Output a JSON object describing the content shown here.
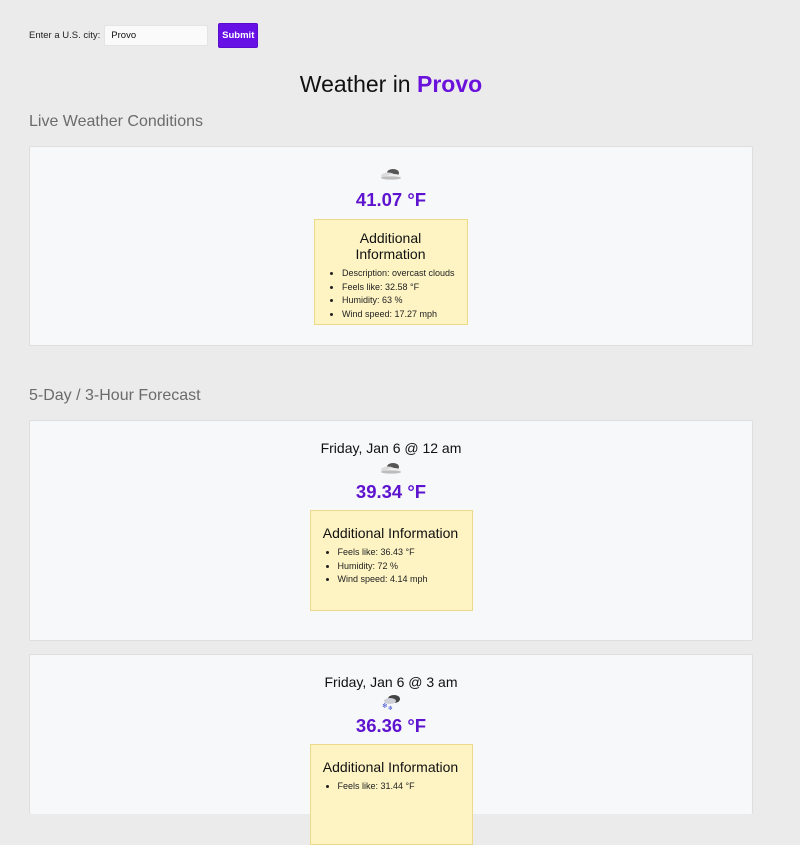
{
  "search": {
    "label": "Enter a U.S. city:",
    "value": "Provo",
    "submit_label": "Submit"
  },
  "title": {
    "prefix": "Weather in",
    "city": "Provo"
  },
  "live": {
    "heading": "Live Weather Conditions",
    "icon": "overcast-clouds-icon",
    "temp": "41.07 °F",
    "info_title": "Additional Information",
    "details": [
      "Description: overcast clouds",
      "Feels like: 32.58 °F",
      "Humidity: 63 %",
      "Wind speed: 17.27 mph"
    ]
  },
  "forecast": {
    "heading": "5-Day / 3-Hour Forecast",
    "items": [
      {
        "date": "Friday, Jan 6 @ 12 am",
        "icon": "overcast-clouds-icon",
        "temp": "39.34 °F",
        "info_title": "Additional Information",
        "details": [
          "Feels like: 36.43 °F",
          "Humidity: 72 %",
          "Wind speed: 4.14 mph"
        ]
      },
      {
        "date": "Friday, Jan 6 @ 3 am",
        "icon": "snow-icon",
        "temp": "36.36 °F",
        "info_title": "Additional Information",
        "details": [
          "Feels like: 31.44 °F"
        ]
      }
    ]
  },
  "colors": {
    "accent": "#6711e6",
    "temp": "#5e13cf",
    "info_bg": "#fdf3c3",
    "page_bg": "#ebebeb",
    "card_bg": "#f7f8fa"
  }
}
